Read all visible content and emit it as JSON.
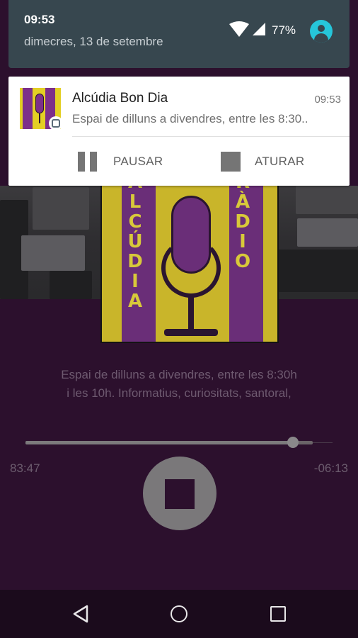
{
  "status_bar": {
    "time": "09:53",
    "date": "dimecres, 13 de setembre",
    "battery": "77%"
  },
  "notification": {
    "title": "Alcúdia Bon Dia",
    "time": "09:53",
    "text": "Espai de dilluns a divendres, entre les 8:30..",
    "actions": [
      {
        "label": "PAUSAR",
        "icon": "pause-icon"
      },
      {
        "label": "ATURAR",
        "icon": "stop-icon"
      }
    ]
  },
  "cover": {
    "left_text": "ALCÚDIA",
    "right_text": "RÀDIO"
  },
  "player": {
    "description_line1": "Espai de dilluns a divendres, entre les 8:30h",
    "description_line2": "i les 10h. Informatius, curiositats, santoral,",
    "elapsed": "83:47",
    "remaining": "-06:13",
    "progress": 0.93
  },
  "colors": {
    "background": "#2c102d",
    "notification_shade": "#37474f",
    "accent": "#26c6da"
  }
}
